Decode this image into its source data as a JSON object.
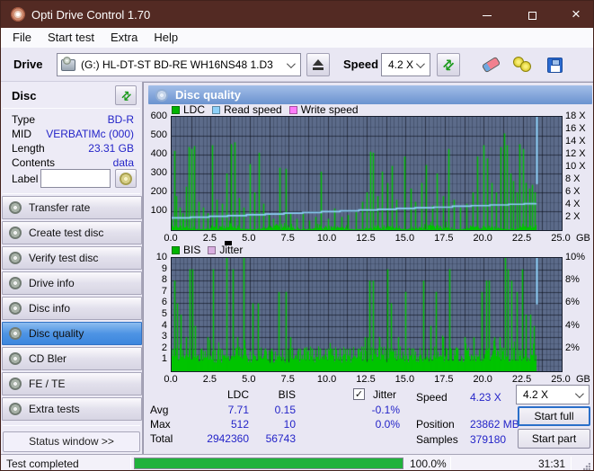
{
  "window": {
    "title": "Opti Drive Control 1.70"
  },
  "menu": {
    "items": [
      "File",
      "Start test",
      "Extra",
      "Help"
    ]
  },
  "toolbar": {
    "drive_label": "Drive",
    "drive_value": "(G:)   HL-DT-ST BD-RE  WH16NS48 1.D3",
    "speed_label": "Speed",
    "speed_value": "4.2 X"
  },
  "sidebar": {
    "section_title": "Disc",
    "info": [
      {
        "label": "Type",
        "value": "BD-R"
      },
      {
        "label": "MID",
        "value": "VERBATIMc (000)"
      },
      {
        "label": "Length",
        "value": "23.31 GB"
      },
      {
        "label": "Contents",
        "value": "data"
      }
    ],
    "label_row": {
      "label": "Label",
      "value": ""
    },
    "nav": [
      {
        "label": "Transfer rate",
        "selected": false
      },
      {
        "label": "Create test disc",
        "selected": false
      },
      {
        "label": "Verify test disc",
        "selected": false
      },
      {
        "label": "Drive info",
        "selected": false
      },
      {
        "label": "Disc info",
        "selected": false
      },
      {
        "label": "Disc quality",
        "selected": true
      },
      {
        "label": "CD Bler",
        "selected": false
      },
      {
        "label": "FE / TE",
        "selected": false
      },
      {
        "label": "Extra tests",
        "selected": false
      }
    ],
    "status_window_label": "Status window >>"
  },
  "panel": {
    "title": "Disc quality"
  },
  "colors": {
    "titlebar": "#532a23",
    "plot_bg": "#5c6b8a",
    "bar_green": "#00c400",
    "read_speed_blue": "#8dd0f8",
    "write_speed_pink": "#ff7cf8",
    "jitter_pink": "#d9aee0",
    "value_blue": "#2424c8",
    "progress_green": "#21b23c",
    "selected_nav_blue": "#3c86dd"
  },
  "chart_data": [
    {
      "type": "bar",
      "title": "LDC / Read speed / Write speed vs position",
      "legend": [
        {
          "label": "LDC",
          "color": "#00b400"
        },
        {
          "label": "Read speed",
          "color": "#8dd0f8"
        },
        {
          "label": "Write speed",
          "color": "#ff7cf8"
        }
      ],
      "x_range": [
        0,
        25
      ],
      "x_unit": "GB",
      "x_ticks": [
        {
          "label": "0.0",
          "gb": 0
        },
        {
          "label": "2.5",
          "gb": 2.5
        },
        {
          "label": "5.0",
          "gb": 5
        },
        {
          "label": "7.5",
          "gb": 7.5
        },
        {
          "label": "10.0",
          "gb": 10
        },
        {
          "label": "12.5",
          "gb": 12.5
        },
        {
          "label": "15.0",
          "gb": 15
        },
        {
          "label": "17.5",
          "gb": 17.5
        },
        {
          "label": "20.0",
          "gb": 20
        },
        {
          "label": "22.5",
          "gb": 22.5
        },
        {
          "label": "25.0",
          "gb": 25
        }
      ],
      "y_left": {
        "range": [
          0,
          600
        ],
        "ticks": [
          {
            "label": "600",
            "value": 600
          },
          {
            "label": "500",
            "value": 500
          },
          {
            "label": "400",
            "value": 400
          },
          {
            "label": "300",
            "value": 300
          },
          {
            "label": "200",
            "value": 200
          },
          {
            "label": "100",
            "value": 100
          }
        ]
      },
      "y_right": {
        "range": [
          0,
          18
        ],
        "ticks": [
          {
            "label": "18 X",
            "value": 18
          },
          {
            "label": "16 X",
            "value": 16
          },
          {
            "label": "14 X",
            "value": 14
          },
          {
            "label": "12 X",
            "value": 12
          },
          {
            "label": "10 X",
            "value": 10
          },
          {
            "label": "8 X",
            "value": 8
          },
          {
            "label": "6 X",
            "value": 6
          },
          {
            "label": "4 X",
            "value": 4
          },
          {
            "label": "2 X",
            "value": 2
          }
        ]
      },
      "grid": {
        "minor": 50,
        "major": 100
      },
      "data_end_gb": 23.35,
      "bar_color": "#00c400",
      "noise": {
        "kind": "ldc",
        "seed": 7,
        "max": 70
      },
      "spikes": [
        [
          0.15,
          420
        ],
        [
          0.3,
          180
        ],
        [
          0.5,
          120
        ],
        [
          0.7,
          90
        ],
        [
          0.9,
          230
        ],
        [
          1.1,
          440
        ],
        [
          1.25,
          430
        ],
        [
          1.45,
          445
        ],
        [
          1.7,
          150
        ],
        [
          2.0,
          120
        ],
        [
          2.3,
          90
        ],
        [
          2.6,
          450
        ],
        [
          2.9,
          160
        ],
        [
          3.2,
          140
        ],
        [
          3.5,
          300
        ],
        [
          3.8,
          455
        ],
        [
          4.05,
          465
        ],
        [
          4.3,
          170
        ],
        [
          4.6,
          120
        ],
        [
          5.0,
          350
        ],
        [
          5.3,
          200
        ],
        [
          5.6,
          410
        ],
        [
          5.85,
          140
        ],
        [
          6.2,
          80
        ],
        [
          6.5,
          60
        ],
        [
          6.9,
          330
        ],
        [
          7.3,
          325
        ],
        [
          7.6,
          90
        ],
        [
          8.0,
          60
        ],
        [
          8.4,
          85
        ],
        [
          8.8,
          50
        ],
        [
          9.2,
          70
        ],
        [
          9.55,
          310
        ],
        [
          10.0,
          60
        ],
        [
          10.4,
          115
        ],
        [
          10.9,
          70
        ],
        [
          11.3,
          80
        ],
        [
          11.8,
          95
        ],
        [
          12.2,
          150
        ],
        [
          12.5,
          200
        ],
        [
          12.75,
          415
        ],
        [
          12.9,
          410
        ],
        [
          13.2,
          180
        ],
        [
          13.5,
          310
        ],
        [
          13.8,
          250
        ],
        [
          14.1,
          340
        ],
        [
          14.4,
          160
        ],
        [
          14.9,
          390
        ],
        [
          15.3,
          220
        ],
        [
          15.6,
          150
        ],
        [
          16.0,
          250
        ],
        [
          16.3,
          345
        ],
        [
          16.7,
          130
        ],
        [
          17.0,
          300
        ],
        [
          17.4,
          180
        ],
        [
          17.75,
          430
        ],
        [
          18.1,
          160
        ],
        [
          18.5,
          120
        ],
        [
          18.9,
          140
        ],
        [
          19.3,
          200
        ],
        [
          19.6,
          390
        ],
        [
          20.0,
          450
        ],
        [
          20.2,
          380
        ],
        [
          20.5,
          250
        ],
        [
          20.8,
          200
        ],
        [
          21.1,
          440
        ],
        [
          21.3,
          512
        ],
        [
          21.5,
          450
        ],
        [
          21.7,
          300
        ],
        [
          21.9,
          260
        ],
        [
          22.1,
          200
        ],
        [
          22.3,
          455
        ],
        [
          22.5,
          430
        ],
        [
          22.7,
          250
        ],
        [
          22.9,
          220
        ],
        [
          23.1,
          240
        ],
        [
          23.25,
          200
        ]
      ],
      "line": {
        "name": "Read speed",
        "color": "#8dd0f8",
        "axis": "right",
        "range": [
          0,
          18
        ],
        "points": [
          [
            0,
            1.95
          ],
          [
            1.2,
            2.05
          ],
          [
            2.4,
            2.2
          ],
          [
            3.6,
            2.3
          ],
          [
            4.8,
            2.45
          ],
          [
            6,
            2.55
          ],
          [
            7.2,
            2.7
          ],
          [
            8.4,
            2.8
          ],
          [
            9.6,
            2.95
          ],
          [
            10.8,
            3.05
          ],
          [
            12,
            3.2
          ],
          [
            13.2,
            3.3
          ],
          [
            14.4,
            3.45
          ],
          [
            15.6,
            3.55
          ],
          [
            16.8,
            3.65
          ],
          [
            18,
            3.8
          ],
          [
            19.2,
            3.9
          ],
          [
            20.4,
            4.0
          ],
          [
            21.6,
            4.1
          ],
          [
            22.6,
            4.2
          ],
          [
            23.35,
            4.3
          ]
        ]
      },
      "end_marker": {
        "x": 23.4,
        "from": 18,
        "to": 7.3,
        "axis_max": 18,
        "color": "#8dd0f8"
      }
    },
    {
      "type": "bar",
      "title": "BIS / Jitter vs position",
      "legend": [
        {
          "label": "BIS",
          "color": "#00b400"
        },
        {
          "label": "Jitter",
          "color": "#d9aee0"
        }
      ],
      "x_range": [
        0,
        25
      ],
      "x_unit": "GB",
      "x_ticks": [
        {
          "label": "0.0",
          "gb": 0
        },
        {
          "label": "2.5",
          "gb": 2.5
        },
        {
          "label": "5.0",
          "gb": 5
        },
        {
          "label": "7.5",
          "gb": 7.5
        },
        {
          "label": "10.0",
          "gb": 10
        },
        {
          "label": "12.5",
          "gb": 12.5
        },
        {
          "label": "15.0",
          "gb": 15
        },
        {
          "label": "17.5",
          "gb": 17.5
        },
        {
          "label": "20.0",
          "gb": 20
        },
        {
          "label": "22.5",
          "gb": 22.5
        },
        {
          "label": "25.0",
          "gb": 25
        }
      ],
      "y_left": {
        "range": [
          0,
          10
        ],
        "ticks": [
          {
            "label": "10",
            "value": 10
          },
          {
            "label": "9",
            "value": 9
          },
          {
            "label": "8",
            "value": 8
          },
          {
            "label": "7",
            "value": 7
          },
          {
            "label": "6",
            "value": 6
          },
          {
            "label": "5",
            "value": 5
          },
          {
            "label": "4",
            "value": 4
          },
          {
            "label": "3",
            "value": 3
          },
          {
            "label": "2",
            "value": 2
          },
          {
            "label": "1",
            "value": 1
          }
        ]
      },
      "y_right": {
        "range": [
          0,
          10
        ],
        "ticks": [
          {
            "label": "10%",
            "value": 10
          },
          {
            "label": "8%",
            "value": 8
          },
          {
            "label": "6%",
            "value": 6
          },
          {
            "label": "4%",
            "value": 4
          },
          {
            "label": "2%",
            "value": 2
          }
        ]
      },
      "grid": {
        "minor": 0.5,
        "major": 1
      },
      "data_end_gb": 23.35,
      "bar_color": "#00c400",
      "noise": {
        "kind": "bis",
        "seed": 3,
        "base": 1
      },
      "spikes": [
        [
          0.15,
          8
        ],
        [
          0.35,
          6
        ],
        [
          0.6,
          5
        ],
        [
          0.9,
          3
        ],
        [
          1.15,
          9
        ],
        [
          1.3,
          9
        ],
        [
          1.5,
          4
        ],
        [
          1.9,
          2
        ],
        [
          2.3,
          3
        ],
        [
          2.65,
          9
        ],
        [
          3.0,
          2
        ],
        [
          3.5,
          10
        ],
        [
          3.9,
          9
        ],
        [
          4.2,
          3
        ],
        [
          4.6,
          10
        ],
        [
          5.2,
          6
        ],
        [
          5.55,
          6
        ],
        [
          6.0,
          2
        ],
        [
          6.4,
          2
        ],
        [
          6.85,
          7
        ],
        [
          7.3,
          7
        ],
        [
          7.6,
          3
        ],
        [
          8.1,
          2
        ],
        [
          8.5,
          2
        ],
        [
          9.0,
          2
        ],
        [
          9.5,
          2
        ],
        [
          10.2,
          2
        ],
        [
          10.8,
          2
        ],
        [
          11.4,
          2
        ],
        [
          12.0,
          2
        ],
        [
          12.4,
          3
        ],
        [
          12.7,
          8
        ],
        [
          12.9,
          8
        ],
        [
          13.3,
          3
        ],
        [
          13.85,
          9
        ],
        [
          14.05,
          6
        ],
        [
          14.5,
          3
        ],
        [
          14.95,
          7
        ],
        [
          15.4,
          2
        ],
        [
          16.15,
          8
        ],
        [
          16.6,
          4
        ],
        [
          16.95,
          7
        ],
        [
          17.4,
          3
        ],
        [
          17.8,
          9
        ],
        [
          18.3,
          2
        ],
        [
          18.8,
          3
        ],
        [
          19.35,
          3
        ],
        [
          19.85,
          7
        ],
        [
          20.15,
          8
        ],
        [
          20.35,
          8
        ],
        [
          20.7,
          3
        ],
        [
          21.0,
          3
        ],
        [
          21.35,
          10
        ],
        [
          21.55,
          9
        ],
        [
          21.8,
          8
        ],
        [
          22.1,
          7
        ],
        [
          22.45,
          9
        ],
        [
          22.7,
          5
        ],
        [
          23.0,
          5
        ],
        [
          23.2,
          4
        ]
      ],
      "end_marker": {
        "x": 23.4,
        "from": 10,
        "to": 5.9,
        "axis_max": 10,
        "color": "#8dd0f8"
      }
    }
  ],
  "stats": {
    "col_headers": [
      "LDC",
      "BIS"
    ],
    "jitter_checkbox": {
      "label": "Jitter",
      "checked": true,
      "glyph": "✓"
    },
    "rows": [
      {
        "label": "Avg",
        "ldc": "7.71",
        "bis": "0.15",
        "jitter": "-0.1%"
      },
      {
        "label": "Max",
        "ldc": "512",
        "bis": "10",
        "jitter": "0.0%"
      },
      {
        "label": "Total",
        "ldc": "2942360",
        "bis": "56743",
        "jitter": ""
      }
    ],
    "right": [
      {
        "label": "Speed",
        "value": "4.23 X"
      },
      {
        "label": "Position",
        "value": "23862 MB"
      },
      {
        "label": "Samples",
        "value": "379180"
      }
    ],
    "speed_select": "4.2 X",
    "buttons": [
      "Start full",
      "Start part"
    ]
  },
  "statusbar": {
    "status": "Test completed",
    "progress_pct": 100,
    "progress_label": "100.0%",
    "time": "31:31"
  }
}
